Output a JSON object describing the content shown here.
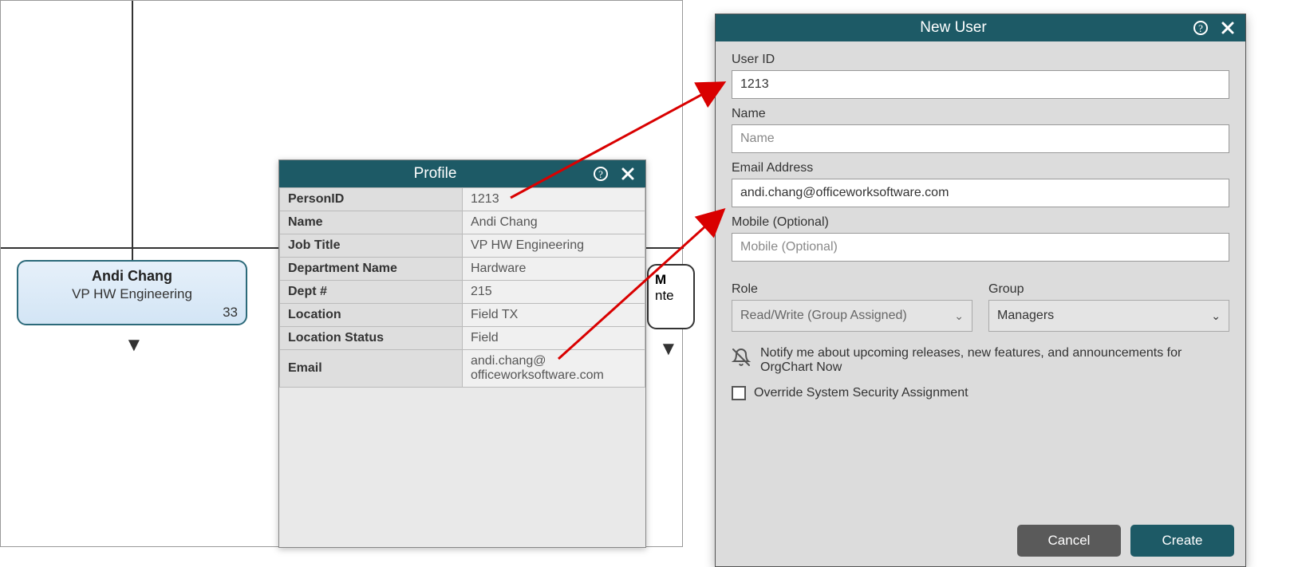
{
  "org_card": {
    "name": "Andi Chang",
    "title": "VP HW Engineering",
    "count": "33"
  },
  "peek": {
    "name_fragment": "M",
    "title_fragment": "nte"
  },
  "profile": {
    "title": "Profile",
    "rows": [
      {
        "label": "PersonID",
        "value": "1213"
      },
      {
        "label": "Name",
        "value": "Andi Chang"
      },
      {
        "label": "Job Title",
        "value": "VP HW Engineering"
      },
      {
        "label": "Department Name",
        "value": "Hardware"
      },
      {
        "label": "Dept #",
        "value": "215"
      },
      {
        "label": "Location",
        "value": "Field TX"
      },
      {
        "label": "Location Status",
        "value": "Field"
      },
      {
        "label": "Email",
        "value": "andi.chang@\nofficeworksoftware.com"
      }
    ]
  },
  "new_user": {
    "title": "New User",
    "labels": {
      "user_id": "User ID",
      "name": "Name",
      "email": "Email Address",
      "mobile": "Mobile (Optional)",
      "role": "Role",
      "group": "Group"
    },
    "values": {
      "user_id": "1213",
      "name": "",
      "email": "andi.chang@officeworksoftware.com",
      "mobile": ""
    },
    "placeholders": {
      "name": "Name",
      "mobile": "Mobile (Optional)"
    },
    "selects": {
      "role": "Read/Write (Group Assigned)",
      "group": "Managers"
    },
    "notify_text": "Notify me about upcoming releases, new features, and announcements for OrgChart Now",
    "override_text": "Override System Security Assignment",
    "buttons": {
      "cancel": "Cancel",
      "create": "Create"
    }
  }
}
